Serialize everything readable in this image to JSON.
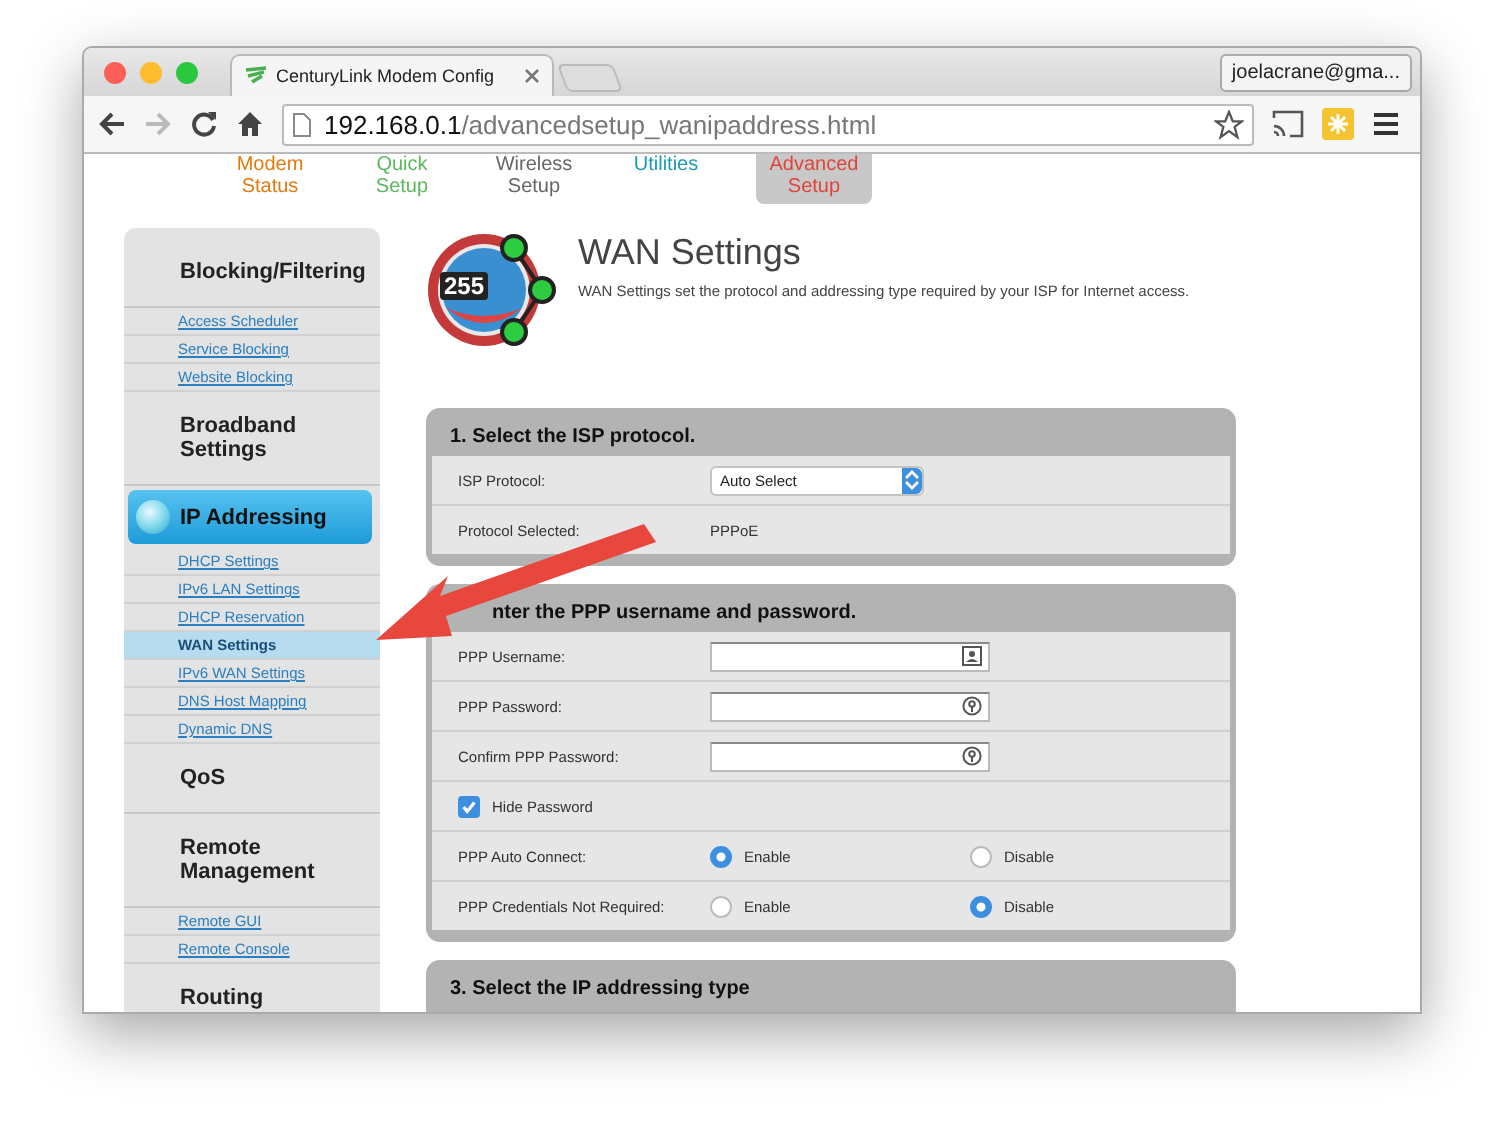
{
  "browser": {
    "tab_title": "CenturyLink Modem Config",
    "profile": "joelacrane@gma...",
    "url_host": "192.168.0.1",
    "url_path": "/advancedsetup_wanipaddress.html",
    "forward_disabled": true
  },
  "nav": [
    {
      "label": "Modem Status",
      "color": "#e07b10",
      "selected": false
    },
    {
      "label": "Quick Setup",
      "color": "#5cb85c",
      "selected": false
    },
    {
      "label": "Wireless Setup",
      "color": "#666666",
      "selected": false
    },
    {
      "label": "Utilities",
      "color": "#1a9bb0",
      "selected": false
    },
    {
      "label": "Advanced Setup",
      "color": "#e0443a",
      "selected": true
    }
  ],
  "sidebar": [
    {
      "title": "Blocking/Filtering",
      "selected": false,
      "items": [
        {
          "label": "Access Scheduler",
          "selected": false
        },
        {
          "label": "Service Blocking",
          "selected": false
        },
        {
          "label": "Website Blocking",
          "selected": false
        }
      ]
    },
    {
      "title": "Broadband Settings",
      "selected": false
    },
    {
      "title": "IP Addressing",
      "selected": true,
      "items": [
        {
          "label": "DHCP Settings",
          "selected": false
        },
        {
          "label": "IPv6 LAN Settings",
          "selected": false
        },
        {
          "label": "DHCP Reservation",
          "selected": false
        },
        {
          "label": "WAN Settings",
          "selected": true
        },
        {
          "label": "IPv6 WAN Settings",
          "selected": false
        },
        {
          "label": "DNS Host Mapping",
          "selected": false
        },
        {
          "label": "Dynamic DNS",
          "selected": false
        }
      ]
    },
    {
      "title": "QoS",
      "selected": false
    },
    {
      "title": "Remote Management",
      "selected": false,
      "items": [
        {
          "label": "Remote GUI",
          "selected": false
        },
        {
          "label": "Remote Console",
          "selected": false
        }
      ]
    },
    {
      "title": "Routing",
      "selected": false
    }
  ],
  "header": {
    "logo_number": "255",
    "title": "WAN Settings",
    "description": "WAN Settings set the protocol and addressing type required by your ISP for Internet access."
  },
  "sections": [
    {
      "title": "1. Select the ISP protocol.",
      "rows": [
        {
          "kind": "select",
          "label": "ISP Protocol:",
          "value": "Auto Select"
        },
        {
          "kind": "text",
          "label": "Protocol Selected:",
          "value": "PPPoE"
        }
      ]
    },
    {
      "title": "nter the PPP username and password.",
      "rows": [
        {
          "kind": "input",
          "label": "PPP Username:"
        },
        {
          "kind": "input",
          "label": "PPP Password:"
        },
        {
          "kind": "input",
          "label": "Confirm PPP Password:"
        },
        {
          "kind": "checkbox",
          "label": "Hide Password",
          "checked": true
        },
        {
          "kind": "radio",
          "label": "PPP Auto Connect:",
          "options": [
            {
              "label": "Enable",
              "selected": true
            },
            {
              "label": "Disable",
              "selected": false
            }
          ]
        },
        {
          "kind": "radio",
          "label": "PPP Credentials Not Required:",
          "options": [
            {
              "label": "Enable",
              "selected": false
            },
            {
              "label": "Disable",
              "selected": true
            }
          ]
        }
      ]
    },
    {
      "title": "3. Select the IP addressing type"
    }
  ]
}
